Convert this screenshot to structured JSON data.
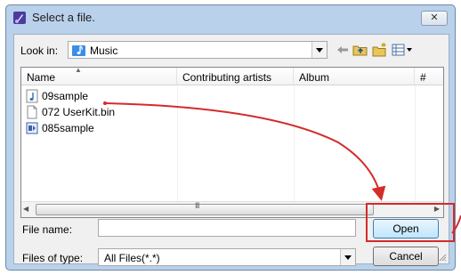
{
  "window": {
    "title": "Select a file.",
    "close_label": "✕"
  },
  "lookin": {
    "label": "Look in:",
    "value": "Music"
  },
  "columns": [
    "Name",
    "Contributing artists",
    "Album",
    "#"
  ],
  "files": [
    {
      "name": "09sample",
      "icon": "music-note-icon"
    },
    {
      "name": "072 UserKit.bin",
      "icon": "blank-file-icon"
    },
    {
      "name": "085sample",
      "icon": "media-file-icon"
    }
  ],
  "scrollbar": {
    "grip": "III"
  },
  "filename": {
    "label": "File name:",
    "value": ""
  },
  "filetype": {
    "label": "Files of type:",
    "value": "All Files(*.*)"
  },
  "buttons": {
    "open": "Open",
    "cancel": "Cancel"
  },
  "annotation_color": "#d42b2b"
}
